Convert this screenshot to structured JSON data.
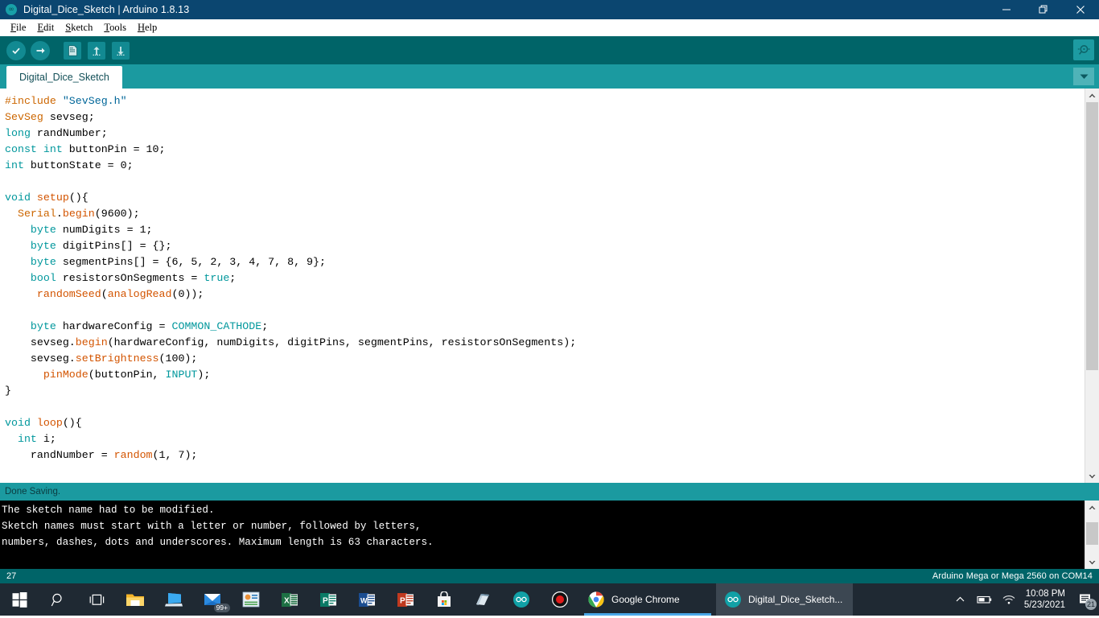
{
  "window": {
    "title": "Digital_Dice_Sketch | Arduino 1.8.13",
    "app_icon": "arduino-infinity-icon",
    "controls": {
      "minimize": "minimize-icon",
      "restore": "restore-icon",
      "close": "close-icon"
    },
    "titlebar_color": "#0b4670"
  },
  "menubar": {
    "items": [
      {
        "mnemonic": "F",
        "rest": "ile"
      },
      {
        "mnemonic": "E",
        "rest": "dit"
      },
      {
        "mnemonic": "S",
        "rest": "ketch"
      },
      {
        "mnemonic": "T",
        "rest": "ools"
      },
      {
        "mnemonic": "H",
        "rest": "elp"
      }
    ]
  },
  "toolbar": {
    "verify_label": "Verify",
    "upload_label": "Upload",
    "new_label": "New",
    "open_label": "Open",
    "save_label": "Save",
    "serial_monitor_label": "Serial Monitor",
    "background": "#006468"
  },
  "tabs": {
    "active": "Digital_Dice_Sketch",
    "menu_icon": "chevron-down-icon"
  },
  "editor": {
    "lines": [
      [
        {
          "t": "#include ",
          "c": "pre"
        },
        {
          "t": "\"SevSeg.h\"",
          "c": "str"
        }
      ],
      [
        {
          "t": "SevSeg",
          "c": "cls"
        },
        {
          "t": " sevseg;",
          "c": ""
        }
      ],
      [
        {
          "t": "long",
          "c": "kw"
        },
        {
          "t": " randNumber;",
          "c": ""
        }
      ],
      [
        {
          "t": "const int",
          "c": "kw"
        },
        {
          "t": " buttonPin = 10;",
          "c": ""
        }
      ],
      [
        {
          "t": "int",
          "c": "kw"
        },
        {
          "t": " buttonState = 0;",
          "c": ""
        }
      ],
      [],
      [
        {
          "t": "void",
          "c": "kw"
        },
        {
          "t": " ",
          "c": ""
        },
        {
          "t": "setup",
          "c": "fn"
        },
        {
          "t": "(){",
          "c": ""
        }
      ],
      [
        {
          "t": "  ",
          "c": ""
        },
        {
          "t": "Serial",
          "c": "cls"
        },
        {
          "t": ".",
          "c": ""
        },
        {
          "t": "begin",
          "c": "fn"
        },
        {
          "t": "(9600);",
          "c": ""
        }
      ],
      [
        {
          "t": "    ",
          "c": ""
        },
        {
          "t": "byte",
          "c": "kw"
        },
        {
          "t": " numDigits = 1;",
          "c": ""
        }
      ],
      [
        {
          "t": "    ",
          "c": ""
        },
        {
          "t": "byte",
          "c": "kw"
        },
        {
          "t": " digitPins[] = {};",
          "c": ""
        }
      ],
      [
        {
          "t": "    ",
          "c": ""
        },
        {
          "t": "byte",
          "c": "kw"
        },
        {
          "t": " segmentPins[] = {6, 5, 2, 3, 4, 7, 8, 9};",
          "c": ""
        }
      ],
      [
        {
          "t": "    ",
          "c": ""
        },
        {
          "t": "bool",
          "c": "kw"
        },
        {
          "t": " resistorsOnSegments = ",
          "c": ""
        },
        {
          "t": "true",
          "c": "lit"
        },
        {
          "t": ";",
          "c": ""
        }
      ],
      [
        {
          "t": "     ",
          "c": ""
        },
        {
          "t": "randomSeed",
          "c": "fn"
        },
        {
          "t": "(",
          "c": ""
        },
        {
          "t": "analogRead",
          "c": "fn"
        },
        {
          "t": "(0));",
          "c": ""
        }
      ],
      [],
      [
        {
          "t": "    ",
          "c": ""
        },
        {
          "t": "byte",
          "c": "kw"
        },
        {
          "t": " hardwareConfig = ",
          "c": ""
        },
        {
          "t": "COMMON_CATHODE",
          "c": "lit"
        },
        {
          "t": ";",
          "c": ""
        }
      ],
      [
        {
          "t": "    sevseg.",
          "c": ""
        },
        {
          "t": "begin",
          "c": "fn"
        },
        {
          "t": "(hardwareConfig, numDigits, digitPins, segmentPins, resistorsOnSegments);",
          "c": ""
        }
      ],
      [
        {
          "t": "    sevseg.",
          "c": ""
        },
        {
          "t": "setBrightness",
          "c": "fn"
        },
        {
          "t": "(100);",
          "c": ""
        }
      ],
      [
        {
          "t": "      ",
          "c": ""
        },
        {
          "t": "pinMode",
          "c": "fn"
        },
        {
          "t": "(buttonPin, ",
          "c": ""
        },
        {
          "t": "INPUT",
          "c": "lit"
        },
        {
          "t": ");",
          "c": ""
        }
      ],
      [
        {
          "t": "}",
          "c": ""
        }
      ],
      [],
      [
        {
          "t": "void",
          "c": "kw"
        },
        {
          "t": " ",
          "c": ""
        },
        {
          "t": "loop",
          "c": "fn"
        },
        {
          "t": "(){",
          "c": ""
        }
      ],
      [
        {
          "t": "  ",
          "c": ""
        },
        {
          "t": "int",
          "c": "kw"
        },
        {
          "t": " i;",
          "c": ""
        }
      ],
      [
        {
          "t": "    randNumber = ",
          "c": ""
        },
        {
          "t": "random",
          "c": "fn"
        },
        {
          "t": "(1, 7);",
          "c": ""
        }
      ]
    ],
    "scrollbar": {
      "up_icon": "chevron-up-icon",
      "down_icon": "chevron-down-icon"
    }
  },
  "status_strip": {
    "message": "Done Saving."
  },
  "console": {
    "lines": [
      "The sketch name had to be modified.",
      "Sketch names must start with a letter or number, followed by letters,",
      "numbers, dashes, dots and underscores. Maximum length is 63 characters."
    ],
    "scrollbar": {
      "up_icon": "chevron-up-icon",
      "down_icon": "chevron-down-icon"
    }
  },
  "statusbar": {
    "line_number": "27",
    "board_info": "Arduino Mega or Mega 2560 on COM14"
  },
  "taskbar": {
    "start_icon": "windows-start-icon",
    "search_icon": "search-icon",
    "taskview_icon": "task-view-icon",
    "pinned": [
      {
        "name": "file-explorer-icon",
        "label": "File Explorer"
      },
      {
        "name": "remote-desktop-icon",
        "label": "Remote Desktop"
      },
      {
        "name": "mail-icon",
        "label": "Mail",
        "badge": "99+"
      },
      {
        "name": "office-icon",
        "label": "Office"
      },
      {
        "name": "excel-icon",
        "label": "Excel"
      },
      {
        "name": "publisher-icon",
        "label": "Publisher"
      },
      {
        "name": "word-icon",
        "label": "Word"
      },
      {
        "name": "powerpoint-icon",
        "label": "PowerPoint"
      },
      {
        "name": "microsoft-store-icon",
        "label": "Microsoft Store"
      },
      {
        "name": "sticky-notes-icon",
        "label": "Sticky Notes"
      },
      {
        "name": "arduino-icon",
        "label": "Arduino"
      },
      {
        "name": "record-icon",
        "label": "Screen Recorder"
      }
    ],
    "tasks": [
      {
        "label": "Google Chrome",
        "icon": "chrome-icon",
        "active": false
      },
      {
        "label": "Digital_Dice_Sketch...",
        "icon": "arduino-icon",
        "active": true
      }
    ],
    "tray": {
      "overflow_icon": "chevron-up-icon",
      "battery_icon": "battery-icon",
      "network_icon": "wifi-icon",
      "time": "10:08 PM",
      "date": "5/23/2021",
      "notifications_icon": "notifications-icon",
      "notifications_count": "21"
    }
  }
}
